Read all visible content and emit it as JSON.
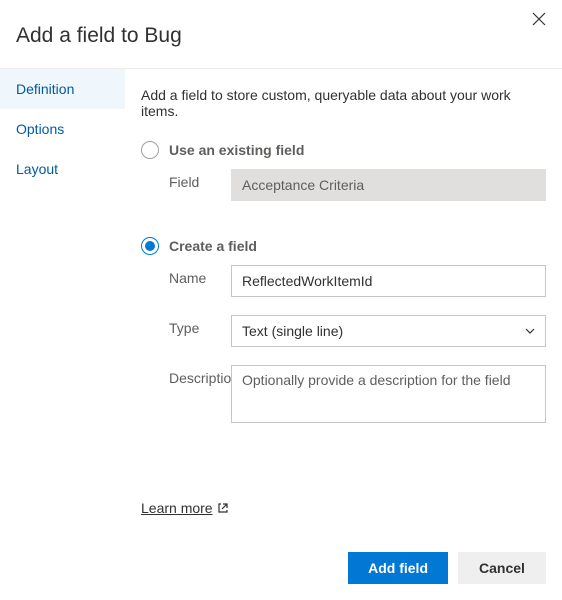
{
  "dialog": {
    "title": "Add a field to Bug",
    "intro": "Add a field to store custom, queryable data about your work items."
  },
  "sidebar": {
    "items": [
      {
        "label": "Definition",
        "active": true
      },
      {
        "label": "Options",
        "active": false
      },
      {
        "label": "Layout",
        "active": false
      }
    ]
  },
  "existing": {
    "radioLabel": "Use an existing field",
    "fieldLabel": "Field",
    "fieldValue": "Acceptance Criteria"
  },
  "create": {
    "radioLabel": "Create a field",
    "nameLabel": "Name",
    "nameValue": "ReflectedWorkItemId",
    "typeLabel": "Type",
    "typeValue": "Text (single line)",
    "descLabel": "Description",
    "descPlaceholder": "Optionally provide a description for the field"
  },
  "footer": {
    "learnMore": "Learn more",
    "addField": "Add field",
    "cancel": "Cancel"
  }
}
